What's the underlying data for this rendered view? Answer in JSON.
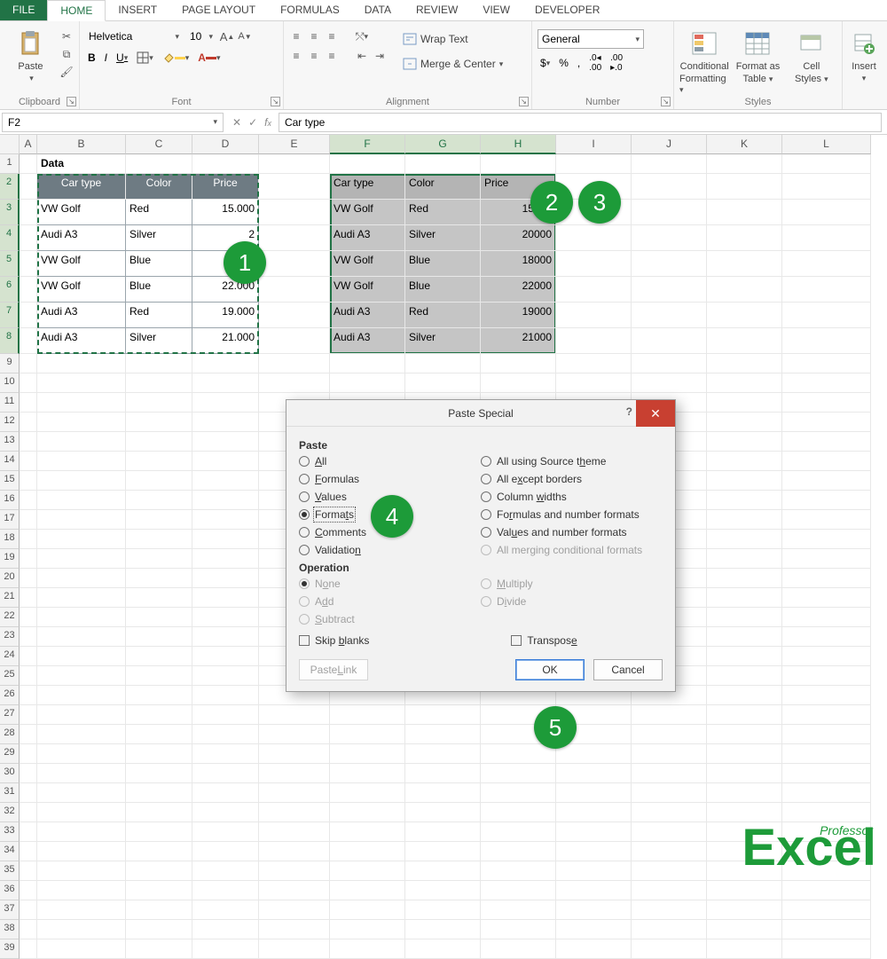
{
  "tabs": {
    "file": "FILE",
    "home": "HOME",
    "insert": "INSERT",
    "pagelayout": "PAGE LAYOUT",
    "formulas": "FORMULAS",
    "data": "DATA",
    "review": "REVIEW",
    "view": "VIEW",
    "developer": "DEVELOPER"
  },
  "ribbon": {
    "clipboard_label": "Clipboard",
    "paste": "Paste",
    "font_label": "Font",
    "font_name": "Helvetica",
    "font_size": "10",
    "align_label": "Alignment",
    "wrap": "Wrap Text",
    "merge": "Merge & Center",
    "number_label": "Number",
    "number_format": "General",
    "styles_label": "Styles",
    "cond": "Conditional",
    "cond2": "Formatting",
    "fmtas": "Format as",
    "fmtas2": "Table",
    "cellstyles": "Cell",
    "cellstyles2": "Styles",
    "cells_label": "",
    "insert": "Insert"
  },
  "formula_bar": {
    "cell": "F2",
    "value": "Car type"
  },
  "columns": [
    "A",
    "B",
    "C",
    "D",
    "E",
    "F",
    "G",
    "H",
    "I",
    "J",
    "K",
    "L"
  ],
  "rows_count": 39,
  "source": {
    "title": "Data",
    "headers": [
      "Car type",
      "Color",
      "Price"
    ],
    "rows": [
      [
        "VW Golf",
        "Red",
        "15.000"
      ],
      [
        "Audi A3",
        "Silver",
        "2"
      ],
      [
        "VW Golf",
        "Blue",
        "1"
      ],
      [
        "VW Golf",
        "Blue",
        "22.000"
      ],
      [
        "Audi A3",
        "Red",
        "19.000"
      ],
      [
        "Audi A3",
        "Silver",
        "21.000"
      ]
    ]
  },
  "dest": {
    "headers": [
      "Car type",
      "Color",
      "Price"
    ],
    "rows": [
      [
        "VW Golf",
        "Red",
        "15000"
      ],
      [
        "Audi A3",
        "Silver",
        "20000"
      ],
      [
        "VW Golf",
        "Blue",
        "18000"
      ],
      [
        "VW Golf",
        "Blue",
        "22000"
      ],
      [
        "Audi A3",
        "Red",
        "19000"
      ],
      [
        "Audi A3",
        "Silver",
        "21000"
      ]
    ]
  },
  "dialog": {
    "title": "Paste Special",
    "paste": "Paste",
    "all": "All",
    "formulas": "Formulas",
    "values": "Values",
    "formats": "Formats",
    "comments": "Comments",
    "validation": "Validation",
    "theme": "All using Source theme",
    "exborders": "All except borders",
    "colwidths": "Column widths",
    "fnum": "Formulas and number formats",
    "vnum": "Values and number formats",
    "mergecond": "All merging conditional formats",
    "operation": "Operation",
    "none": "None",
    "add": "Add",
    "subtract": "Subtract",
    "multiply": "Multiply",
    "divide": "Divide",
    "skip": "Skip blanks",
    "transpose": "Transpose",
    "pastelink": "Paste Link",
    "ok": "OK",
    "cancel": "Cancel"
  },
  "annotations": {
    "a1": "1",
    "a2": "2",
    "a3": "3",
    "a4": "4",
    "a5": "5"
  },
  "logo": {
    "big": "Excel",
    "small": "Professor"
  }
}
